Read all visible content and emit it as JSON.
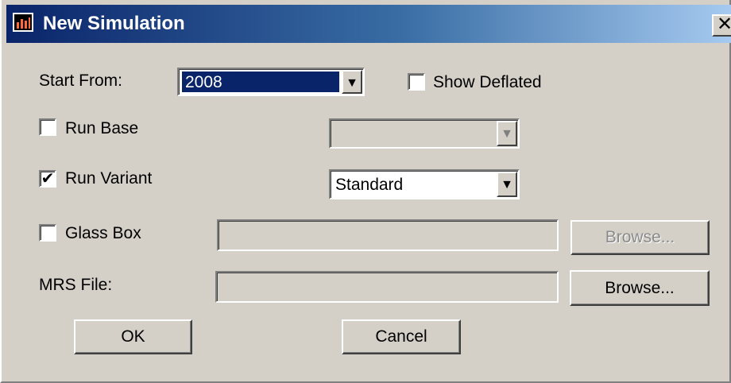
{
  "window": {
    "title": "New Simulation",
    "close_glyph": "✕"
  },
  "form": {
    "start_from_label": "Start From:",
    "start_from_value": "2008",
    "show_deflated_label": "Show Deflated",
    "show_deflated_checked": false,
    "run_base_label": "Run Base",
    "run_base_checked": false,
    "run_base_value": "",
    "run_variant_label": "Run Variant",
    "run_variant_checked": true,
    "run_variant_value": "Standard",
    "glass_box_label": "Glass Box",
    "glass_box_checked": false,
    "glass_box_browse": "Browse...",
    "mrs_file_label": "MRS File:",
    "mrs_file_browse": "Browse..."
  },
  "buttons": {
    "ok": "OK",
    "cancel": "Cancel"
  },
  "glyphs": {
    "check": "✔",
    "dropdown_arrow": "▼"
  },
  "colors": {
    "titlebar_start": "#0a246a",
    "titlebar_end": "#a6caf0",
    "face": "#d4d0c8",
    "selection": "#0a246a"
  }
}
